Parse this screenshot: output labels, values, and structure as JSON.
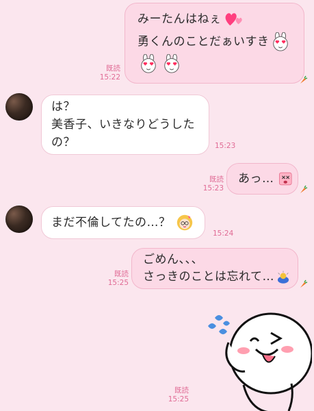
{
  "colors": {
    "background": "#fbe6ee",
    "my_bubble": "#fcd9e6",
    "their_bubble": "#ffffff",
    "meta_text": "#e06b95",
    "carrot": "#f07a2a"
  },
  "messages": [
    {
      "from": "me",
      "lines": [
        "みーたんはねぇ",
        "勇くんのことだぁいすき"
      ],
      "read_label": "既読",
      "time": "15:22",
      "icons": [
        "pink-hearts-icon",
        "heart-eyes-bunny-icon",
        "heart-eyes-bunny-icon",
        "heart-eyes-bunny-icon",
        "carrot-icon"
      ]
    },
    {
      "from": "them",
      "lines": [
        "は？",
        "美香子、いきなりどうした",
        "の？"
      ],
      "time": "15:23",
      "icons": [
        "avatar"
      ]
    },
    {
      "from": "me",
      "lines": [
        "あっ…"
      ],
      "read_label": "既読",
      "time": "15:23",
      "icons": [
        "shocked-face-icon",
        "carrot-icon"
      ]
    },
    {
      "from": "them",
      "lines": [
        "まだ不倫してたの…？"
      ],
      "time": "15:24",
      "icons": [
        "avatar",
        "blonde-girl-icon"
      ]
    },
    {
      "from": "me",
      "lines": [
        "ごめん、、、",
        "さっきのことは忘れて…"
      ],
      "read_label": "既読",
      "time": "15:25",
      "icons": [
        "bowing-person-icon",
        "carrot-icon"
      ]
    },
    {
      "from": "me",
      "type": "sticker",
      "read_label": "既読",
      "time": "15:25",
      "icons": [
        "winking-moon-sticker-icon"
      ]
    }
  ]
}
